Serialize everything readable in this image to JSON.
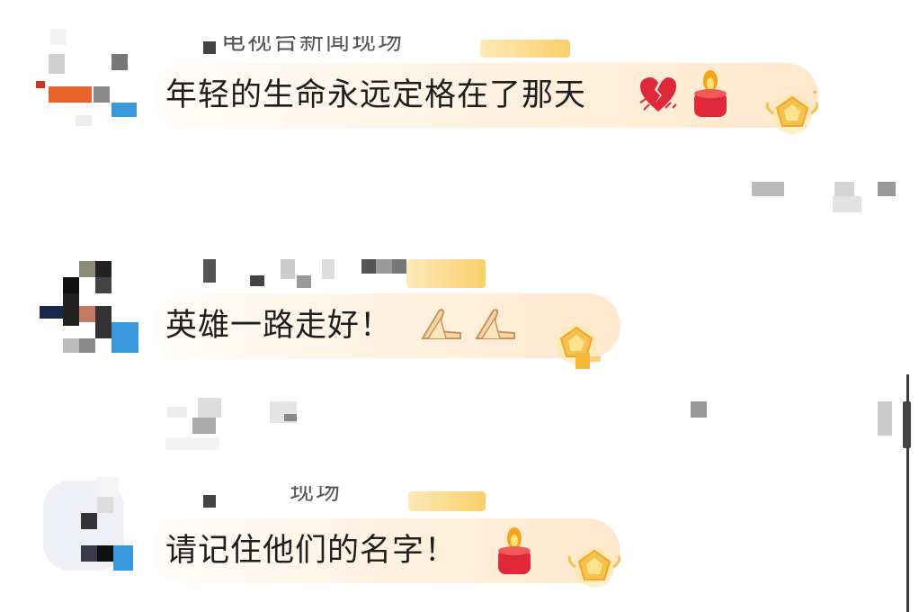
{
  "comments": [
    {
      "username_partial": "电视台新闻现场",
      "text": "年轻的生命永远定格在了那天",
      "emojis": [
        "broken-heart",
        "candle"
      ],
      "badge_icon": "gold-medal",
      "metadata_obscured": true
    },
    {
      "username_partial": "",
      "text": "英雄一路走好！",
      "emojis": [
        "folded-hands",
        "folded-hands"
      ],
      "badge_icon": "gold-medal",
      "metadata_obscured": true
    },
    {
      "username_partial": "现场",
      "text": "请记住他们的名字！",
      "emojis": [
        "candle"
      ],
      "badge_icon": "gold-medal",
      "metadata_obscured": true
    }
  ],
  "colors": {
    "accent_orange": "#e8622a",
    "accent_blue": "#3a98dc",
    "badge_gold": "#f7c14d",
    "bubble_peach": "#ffe7cc",
    "text": "#1e1e1e"
  }
}
